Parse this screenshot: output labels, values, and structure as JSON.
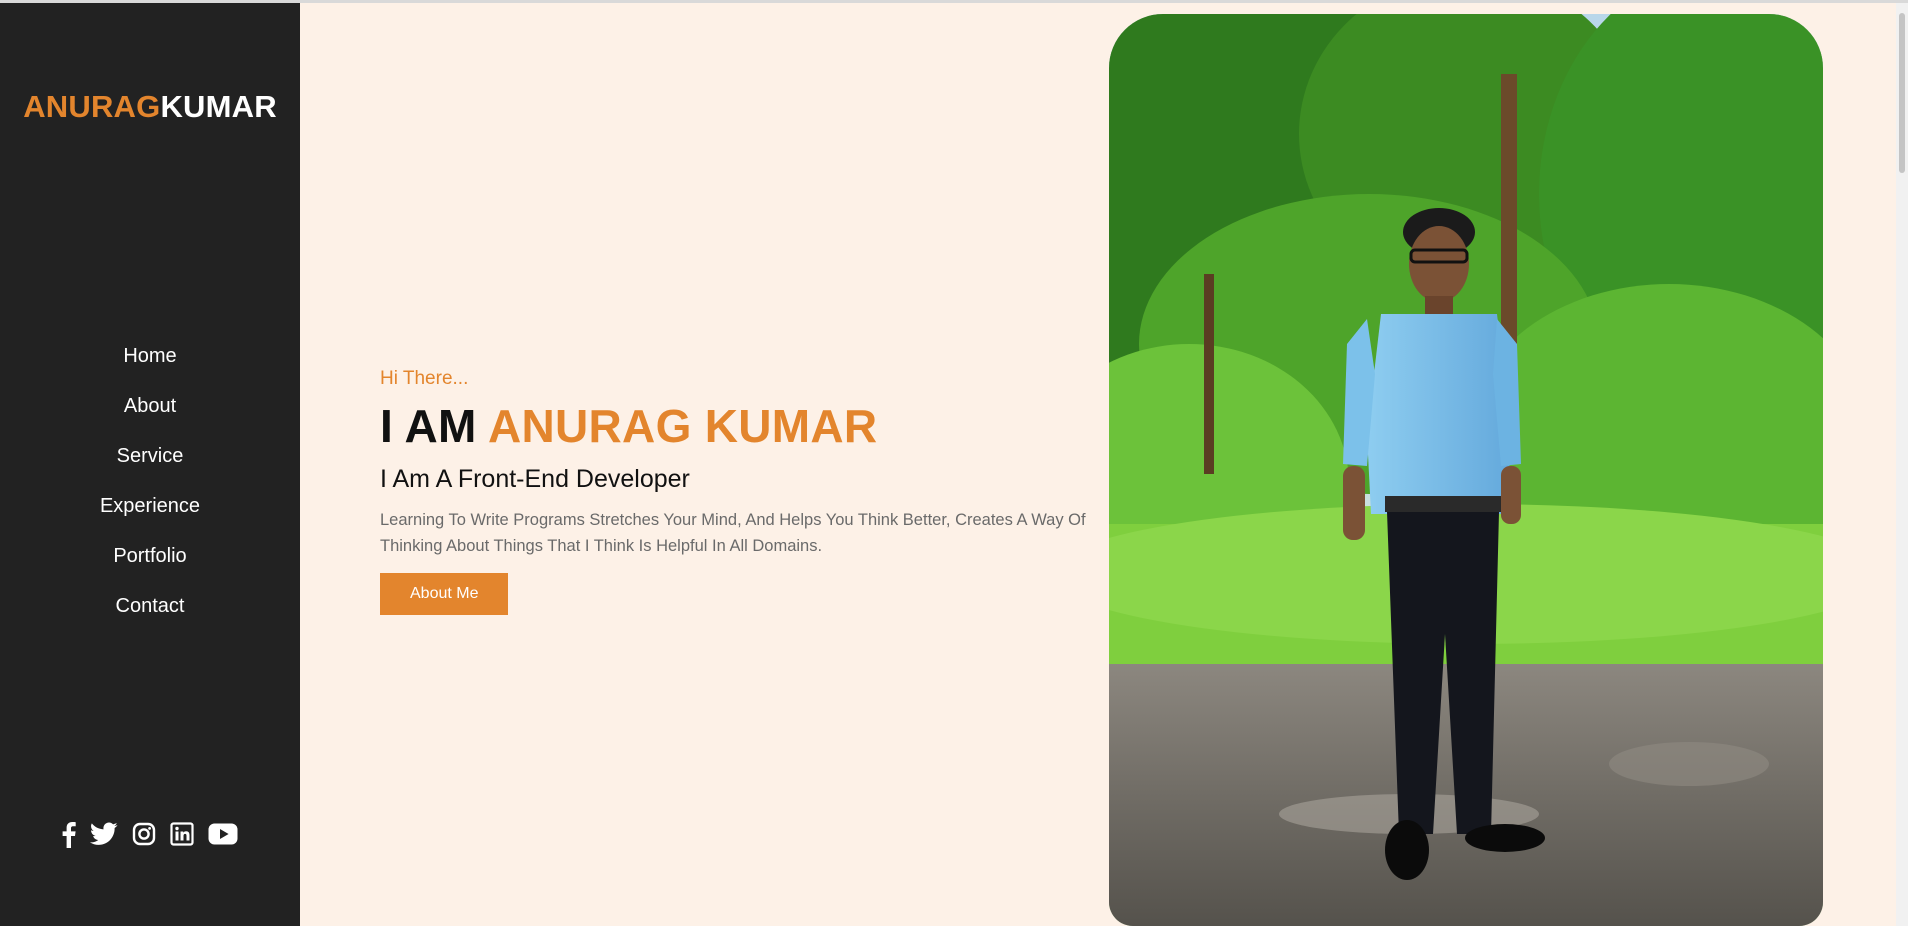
{
  "brand": {
    "first": "ANURAG",
    "last": "KUMAR",
    "accent_color": "#e3852d"
  },
  "nav": {
    "items": [
      {
        "label": "Home"
      },
      {
        "label": "About"
      },
      {
        "label": "Service"
      },
      {
        "label": "Experience"
      },
      {
        "label": "Portfolio"
      },
      {
        "label": "Contact"
      }
    ]
  },
  "social": {
    "icons": [
      "facebook-icon",
      "twitter-icon",
      "instagram-icon",
      "linkedin-icon",
      "youtube-icon"
    ]
  },
  "hero": {
    "greeting": "Hi There...",
    "headline_prefix": "I AM",
    "headline_name": "ANURAG KUMAR",
    "role": "I Am A Front-End Developer",
    "description": "Learning To Write Programs Stretches Your Mind, And Helps You Think Better, Creates A Way Of Thinking About Things That I Think Is Helpful In All Domains.",
    "cta_label": "About Me"
  },
  "colors": {
    "sidebar_bg": "#222222",
    "page_bg": "#fdf1e7",
    "accent": "#e3852d"
  }
}
